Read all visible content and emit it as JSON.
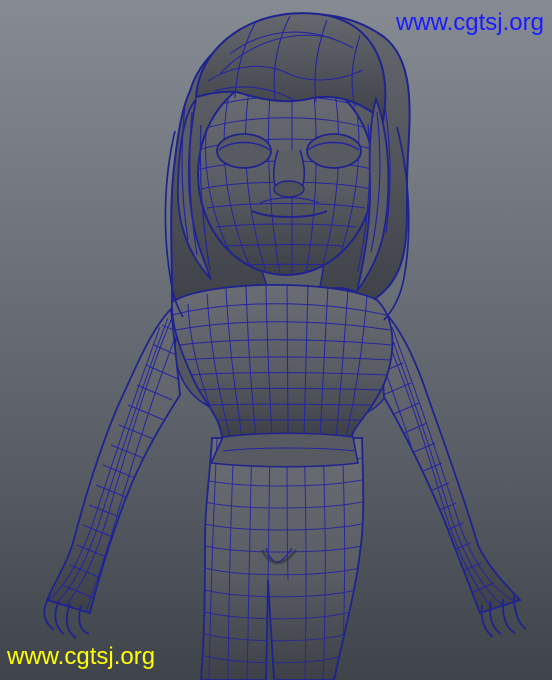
{
  "viewport": {
    "background_top": "#868b93",
    "background_bottom": "#3f434a",
    "model_fill": "#5e6067",
    "model_shadow": "#2f3238",
    "wire_color": "#2424a0"
  },
  "watermarks": {
    "top": {
      "text": "www.cgtsj.org",
      "color": "#1a1aff"
    },
    "bottom": {
      "text": "www.cgtsj.org",
      "color": "#ffff00"
    }
  },
  "model": {
    "subject": "cartoon girl character",
    "display_mode": "wireframe on shaded",
    "pose": "A-pose"
  }
}
